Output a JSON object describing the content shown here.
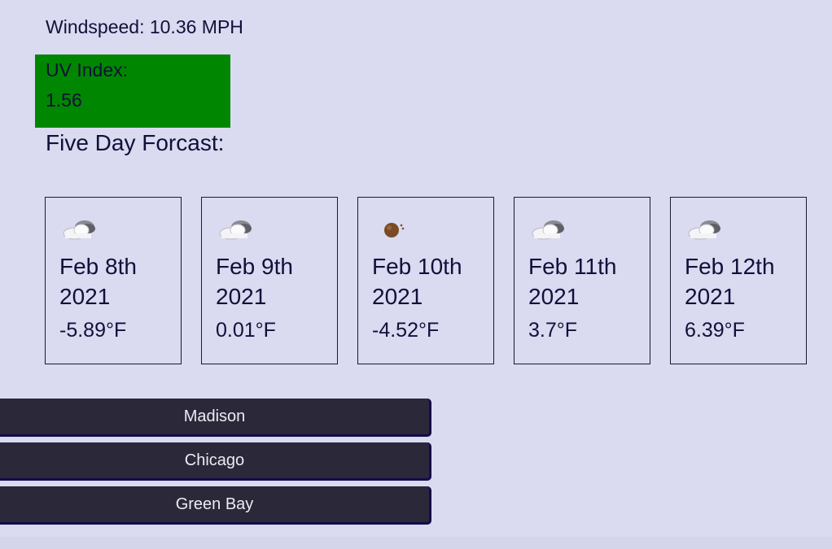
{
  "current": {
    "windspeed_text": "Windspeed: 10.36 MPH",
    "uv_label": "UV Index:",
    "uv_value": "1.56",
    "uv_color": "#018601"
  },
  "forecast": {
    "title": "Five Day Forcast:",
    "days": [
      {
        "icon": "cloudy-icon",
        "date": "Feb 8th 2021",
        "temp": "-5.89°F"
      },
      {
        "icon": "cloudy-icon",
        "date": "Feb 9th 2021",
        "temp": "0.01°F"
      },
      {
        "icon": "moon-icon",
        "date": "Feb 10th 2021",
        "temp": "-4.52°F"
      },
      {
        "icon": "cloudy-icon",
        "date": "Feb 11th 2021",
        "temp": "3.7°F"
      },
      {
        "icon": "cloudy-icon",
        "date": "Feb 12th 2021",
        "temp": "6.39°F"
      }
    ]
  },
  "search_history": [
    {
      "label": "Madison"
    },
    {
      "label": "Chicago"
    },
    {
      "label": "Green Bay"
    }
  ],
  "colors": {
    "background": "#dadaf0",
    "text": "#12103a",
    "button": "#2a2839"
  }
}
